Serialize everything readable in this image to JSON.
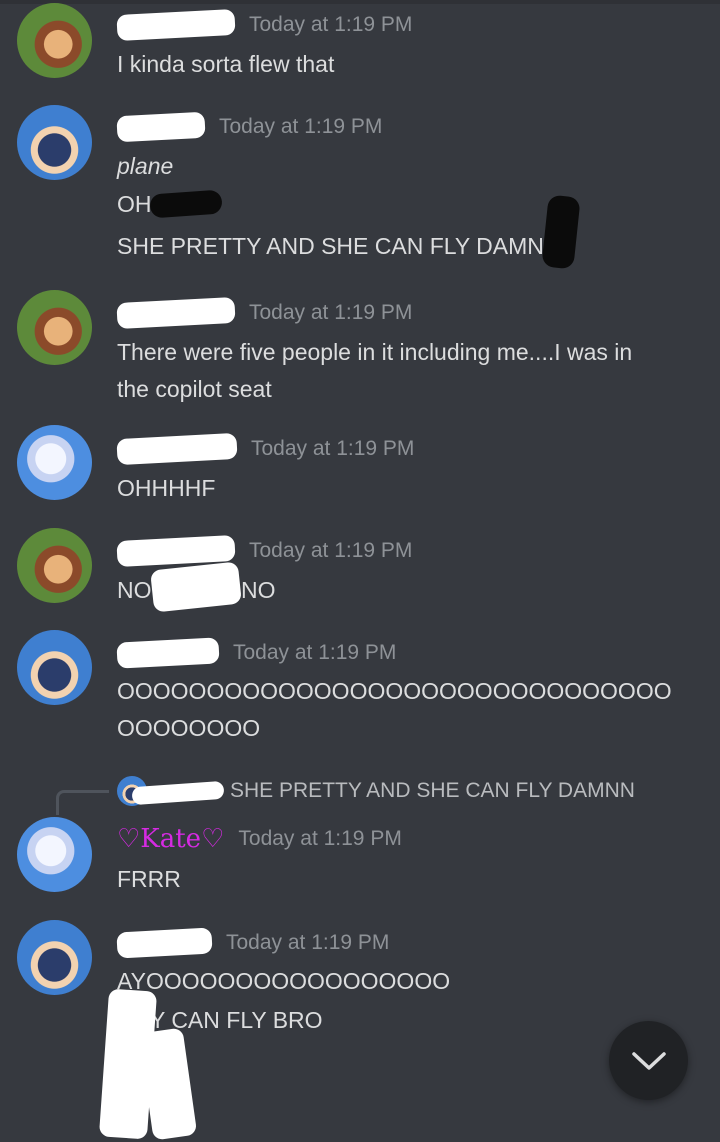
{
  "messages": [
    {
      "author": "",
      "time": "Today at 1:19 PM",
      "lines": [
        "I kinda sorta flew that"
      ]
    },
    {
      "author": "",
      "time": "Today at 1:19 PM",
      "lines": [
        "plane",
        "OH",
        "SHE PRETTY AND SHE CAN FLY DAMN"
      ]
    },
    {
      "author": "",
      "time": "Today at 1:19 PM",
      "lines": [
        "There were five people in it including me....I was in",
        "the copilot seat"
      ]
    },
    {
      "author": "",
      "time": "Today at 1:19 PM",
      "lines": [
        "OHHHHF"
      ]
    },
    {
      "author": "",
      "time": "Today at 1:19 PM",
      "lines": [
        "NO",
        "NO"
      ]
    },
    {
      "author": "",
      "time": "Today at 1:19 PM",
      "lines": [
        "OOOOOOOOOOOOOOOOOOOOOOOOOOOOOOO",
        "OOOOOOOO"
      ]
    },
    {
      "author": "♡Kate♡",
      "time": "Today at 1:19 PM",
      "reply_text": "SHE PRETTY AND SHE CAN FLY DAMNN",
      "lines": [
        "FRRR"
      ]
    },
    {
      "author": "",
      "time": "Today at 1:19 PM",
      "lines": [
        "AYOOOOOOOOOOOOOOOOO",
        "Y CAN FLY BRO",
        "*"
      ]
    }
  ],
  "scroll_button": {
    "icon": "chevron-down-icon"
  }
}
